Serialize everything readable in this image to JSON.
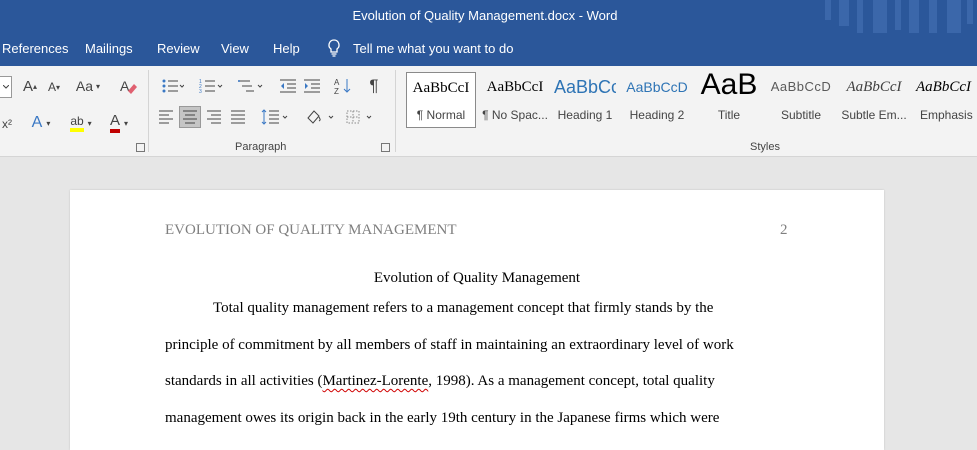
{
  "window": {
    "title": "Evolution of Quality Management.docx  -  Word"
  },
  "menu": {
    "items": [
      "References",
      "Mailings",
      "Review",
      "View",
      "Help"
    ],
    "tell_me": "Tell me what you want to do"
  },
  "ribbon": {
    "groups": {
      "paragraph_label": "Paragraph",
      "styles_label": "Styles"
    },
    "font": {
      "grow": "A",
      "shrink": "A",
      "change_case": "Aa",
      "font_color": "A",
      "highlight": "ab",
      "text_effects": "A"
    },
    "pilcrow": "¶",
    "styles": [
      {
        "preview": "AaBbCcI",
        "name": "¶ Normal"
      },
      {
        "preview": "AaBbCcI",
        "name": "¶ No Spac..."
      },
      {
        "preview": "AaBbCc",
        "name": "Heading 1"
      },
      {
        "preview": "AaBbCcD",
        "name": "Heading 2"
      },
      {
        "preview": "AaB",
        "name": "Title"
      },
      {
        "preview": "AaBbCcD",
        "name": "Subtitle"
      },
      {
        "preview": "AaBbCcI",
        "name": "Subtle Em..."
      },
      {
        "preview": "AaBbCcI",
        "name": "Emphasis"
      }
    ]
  },
  "document": {
    "header_title": "EVOLUTION OF QUALITY MANAGEMENT",
    "page_number": "2",
    "title": "Evolution of Quality Management",
    "lines": [
      "Total quality management refers to a management concept that firmly stands by the",
      "principle of commitment by all members of staff in maintaining an extraordinary level of work"
    ],
    "line3_pre": "standards in all activities (",
    "line3_misspelled": "Martinez-Lorente",
    "line3_post": ", 1998). As a management concept, total quality",
    "line4": "management owes its origin back in the early 19th century in the Japanese firms which were"
  },
  "colors": {
    "accent": "#2b579a",
    "highlight": "#ffff00",
    "font_red": "#c00000"
  }
}
